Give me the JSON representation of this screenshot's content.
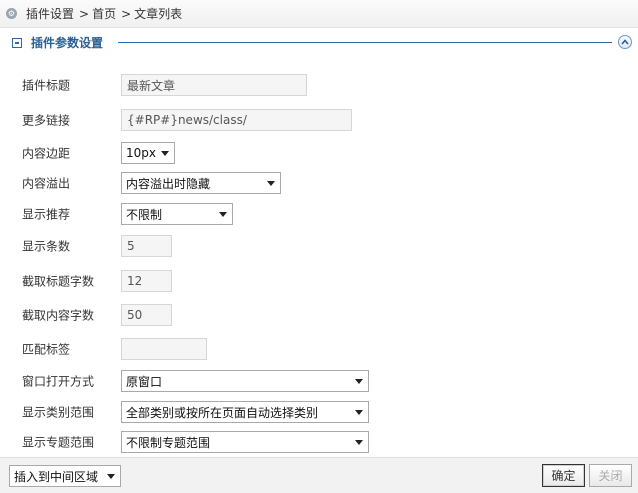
{
  "breadcrumb": {
    "items": [
      "插件设置",
      "首页",
      "文章列表"
    ],
    "separator": ">"
  },
  "section": {
    "title": "插件参数设置"
  },
  "form": {
    "plugin_title": {
      "label": "插件标题",
      "value": "最新文章"
    },
    "more_link": {
      "label": "更多链接",
      "value": "{#RP#}news/class/"
    },
    "content_padding": {
      "label": "内容边距",
      "value": "10px"
    },
    "content_overflow": {
      "label": "内容溢出",
      "value": "内容溢出时隐藏"
    },
    "show_recommend": {
      "label": "显示推荐",
      "value": "不限制"
    },
    "show_count": {
      "label": "显示条数",
      "value": "5"
    },
    "title_chars": {
      "label": "截取标题字数",
      "value": "12"
    },
    "content_chars": {
      "label": "截取内容字数",
      "value": "50"
    },
    "match_tags": {
      "label": "匹配标签",
      "value": ""
    },
    "window_open": {
      "label": "窗口打开方式",
      "value": "原窗口"
    },
    "category_scope": {
      "label": "显示类别范围",
      "value": "全部类别或按所在页面自动选择类别"
    },
    "topic_scope": {
      "label": "显示专题范围",
      "value": "不限制专题范围"
    }
  },
  "footer": {
    "insert_region": "插入到中间区域",
    "confirm_label": "确定",
    "close_label": "关闭"
  },
  "colors": {
    "accent": "#2b5f93",
    "section_line": "#2b6aa8"
  }
}
